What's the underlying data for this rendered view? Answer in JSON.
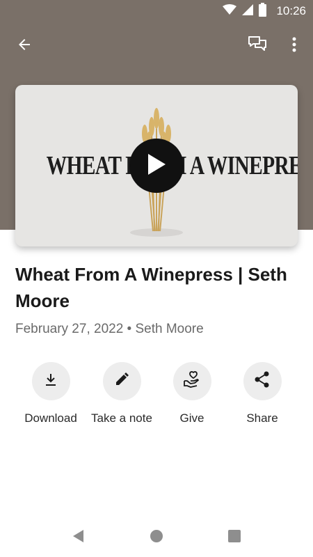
{
  "status_bar": {
    "time": "10:26"
  },
  "video": {
    "thumbnail_text": "WHEAT FROM A WINEPRESS",
    "title": "Wheat From A Winepress | Seth Moore",
    "date": "February 27, 2022",
    "separator": "•",
    "speaker": "Seth Moore"
  },
  "actions": [
    {
      "label": "Download",
      "icon": "download-icon"
    },
    {
      "label": "Take a note",
      "icon": "pencil-icon"
    },
    {
      "label": "Give",
      "icon": "give-heart-hand-icon"
    },
    {
      "label": "Share",
      "icon": "share-icon"
    }
  ],
  "colors": {
    "header_bg": "#7a7068",
    "action_circle": "#ededed",
    "meta_text": "#6a6a6a"
  }
}
